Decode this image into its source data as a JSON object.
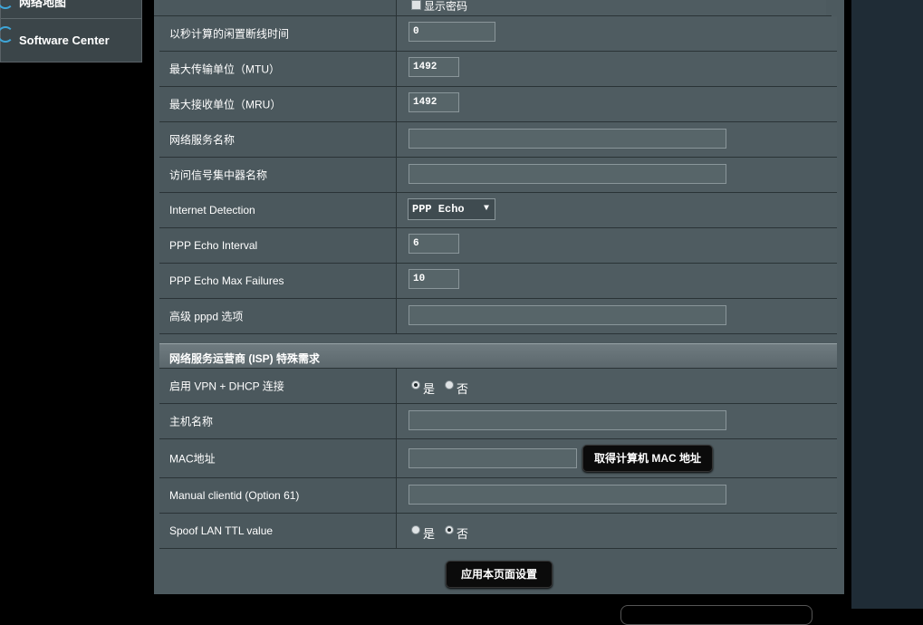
{
  "sidebar": {
    "top_item_label": "网络地图",
    "software_center_label": "Software Center"
  },
  "wan_settings": {
    "show_password_label": "显示密码",
    "idle_label": "以秒计算的闲置断线时间",
    "idle_value": "0",
    "mtu_label": "最大传输单位（MTU）",
    "mtu_value": "1492",
    "mru_label": "最大接收单位（MRU）",
    "mru_value": "1492",
    "service_name_label": "网络服务名称",
    "service_name_value": "",
    "ac_name_label": "访问信号集中器名称",
    "ac_name_value": "",
    "internet_detection_label": "Internet Detection",
    "internet_detection_value": "PPP Echo",
    "echo_interval_label": "PPP Echo Interval",
    "echo_interval_value": "6",
    "echo_max_failures_label": "PPP Echo Max Failures",
    "echo_max_failures_value": "10",
    "pppd_options_label": "高级 pppd 选项",
    "pppd_options_value": ""
  },
  "isp_section": {
    "title": "网络服务运营商 (ISP) 特殊需求",
    "vpn_dhcp_label": "启用 VPN + DHCP 连接",
    "yes": "是",
    "no": "否",
    "hostname_label": "主机名称",
    "hostname_value": "",
    "mac_label": "MAC地址",
    "mac_value": "",
    "clone_mac_button": "取得计算机 MAC 地址",
    "clientid_label": "Manual clientid (Option 61)",
    "clientid_value": "",
    "spoof_ttl_label": "Spoof LAN TTL value"
  },
  "apply_button": "应用本页面设置"
}
